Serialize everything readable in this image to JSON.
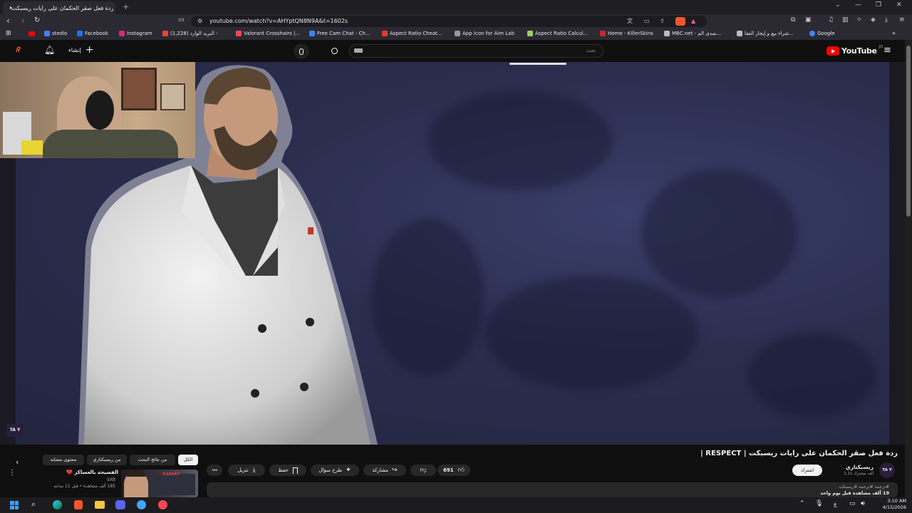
{
  "browser": {
    "tab_title": "ردة فعل صقر الحكمان على رايات ريسبكت",
    "url": "youtube.com/watch?v=AHYptQN8N9A&t=1602s",
    "bookmarks": [
      {
        "label": "stedio",
        "color": "#4a7cff"
      },
      {
        "label": "Facebook",
        "color": "#1877f2"
      },
      {
        "label": "Instagram",
        "color": "#d62976"
      },
      {
        "label": "البريد الوارد (1,228) -",
        "color": "#ea4335"
      },
      {
        "label": "Valorant Crosshairs |...",
        "color": "#ff4655"
      },
      {
        "label": "Free Cam Chat - Ch...",
        "color": "#3b82f6"
      },
      {
        "label": "Aspect Ratio Cheat...",
        "color": "#e53935"
      },
      {
        "label": "App icon for Aim Lab",
        "color": "#999999"
      },
      {
        "label": "Aspect Ratio Calcul...",
        "color": "#9ccc65"
      },
      {
        "label": "Home - KillerSkins",
        "color": "#c62828"
      },
      {
        "label": "MBC.net - صدى الم...",
        "color": "#bbbbbb"
      },
      {
        "label": "شراء بيع و إيجار العقا...",
        "color": "#bbbbbb"
      },
      {
        "label": "Google",
        "color": "#4285f4"
      }
    ]
  },
  "header": {
    "logo_text": "YouTube",
    "logo_super": "JO",
    "search_placeholder": "بحث",
    "create_label": "إنشاء"
  },
  "video": {
    "watermark": "TA Y"
  },
  "details": {
    "title": "ردة فعل صقر الحكمان على رايات ريسبكت | RESPECT |",
    "channel_name": "ريسبكتاري",
    "channel_subs": "1.11 ألف مشترك",
    "subscribe_label": "اشترك",
    "channel_avatar_text": "TA Y",
    "likes": "691",
    "share_label": "مشاركة",
    "ask_label": "طرح سؤال",
    "save_label": "حفظ",
    "download_label": "تنزيل",
    "more_label": "•••",
    "description_stats": "19 ألف مشاهدة  قبل يوم واحد",
    "description_tags": "#ترجمة #ترجمة #ريسبكت"
  },
  "recommended": {
    "chips": [
      "الكل",
      "من نتائج البحث",
      "من ريسبكتاري",
      "محتوى مشابه"
    ],
    "item": {
      "title": "الفضيحة بالعساكر 💔",
      "channel": "SXB",
      "meta1": "185 ألف مشاهدة • قبل 11 ساعة",
      "meta2": "",
      "badge": "9/$8A4/I"
    }
  },
  "taskbar": {
    "time": "3:10 AM",
    "date": "4/15/2026",
    "lang": "ع"
  }
}
